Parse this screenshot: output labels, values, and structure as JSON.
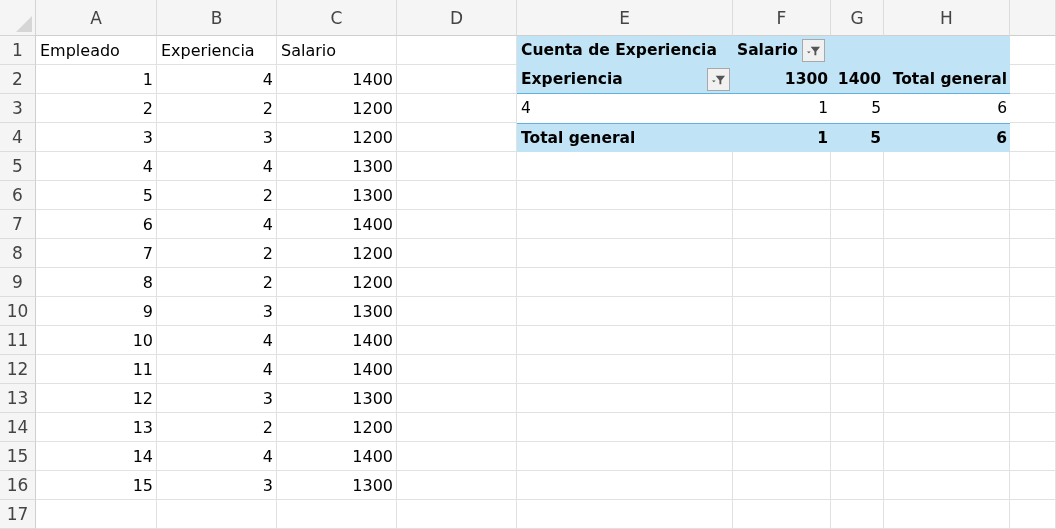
{
  "columns": [
    "A",
    "B",
    "C",
    "D",
    "E",
    "F",
    "G",
    "H"
  ],
  "rows": [
    {
      "number": "1",
      "kind": "header",
      "cells": [
        "Empleado",
        "Experiencia",
        "Salario"
      ]
    },
    {
      "number": "2",
      "kind": "data",
      "cells": [
        "1",
        "4",
        "1400"
      ]
    },
    {
      "number": "3",
      "kind": "data",
      "cells": [
        "2",
        "2",
        "1200"
      ]
    },
    {
      "number": "4",
      "kind": "data",
      "cells": [
        "3",
        "3",
        "1200"
      ]
    },
    {
      "number": "5",
      "kind": "data",
      "cells": [
        "4",
        "4",
        "1300"
      ]
    },
    {
      "number": "6",
      "kind": "data",
      "cells": [
        "5",
        "2",
        "1300"
      ]
    },
    {
      "number": "7",
      "kind": "data",
      "cells": [
        "6",
        "4",
        "1400"
      ]
    },
    {
      "number": "8",
      "kind": "data",
      "cells": [
        "7",
        "2",
        "1200"
      ]
    },
    {
      "number": "9",
      "kind": "data",
      "cells": [
        "8",
        "2",
        "1200"
      ]
    },
    {
      "number": "10",
      "kind": "data",
      "cells": [
        "9",
        "3",
        "1300"
      ]
    },
    {
      "number": "11",
      "kind": "data",
      "cells": [
        "10",
        "4",
        "1400"
      ]
    },
    {
      "number": "12",
      "kind": "data",
      "cells": [
        "11",
        "4",
        "1400"
      ]
    },
    {
      "number": "13",
      "kind": "data",
      "cells": [
        "12",
        "3",
        "1300"
      ]
    },
    {
      "number": "14",
      "kind": "data",
      "cells": [
        "13",
        "2",
        "1200"
      ]
    },
    {
      "number": "15",
      "kind": "data",
      "cells": [
        "14",
        "4",
        "1400"
      ]
    },
    {
      "number": "16",
      "kind": "data",
      "cells": [
        "15",
        "3",
        "1300"
      ]
    },
    {
      "number": "17"
    }
  ],
  "pivot": {
    "corner": "Cuenta de Experiencia",
    "column_field": {
      "label": "Salario",
      "filtered": true
    },
    "row_field": {
      "label": "Experiencia",
      "filtered": true
    },
    "column_items": [
      "1300",
      "1400"
    ],
    "grand_total_column": "Total general",
    "rows": [
      {
        "label": "4",
        "values": [
          "1",
          "5",
          "6"
        ]
      }
    ],
    "total_row": {
      "label": "Total general",
      "values": [
        "1",
        "5",
        "6"
      ]
    }
  }
}
